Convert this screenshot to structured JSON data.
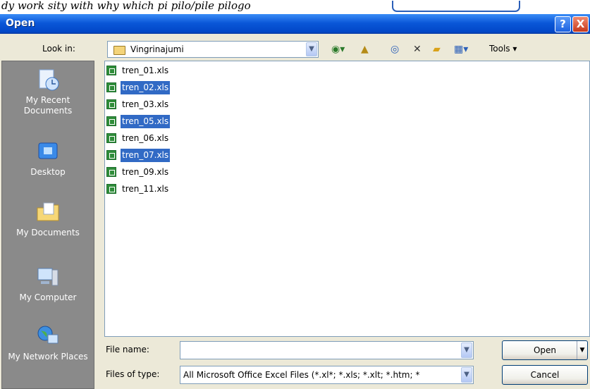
{
  "background": {
    "text": "dy work sity with why which pi pilo/pile pilogo"
  },
  "window": {
    "title": "Open",
    "help_symbol": "?",
    "close_symbol": "X"
  },
  "toolbar": {
    "look_in_label": "Look in:",
    "look_in_value": "Vingrinajumi",
    "tools_label": "Tools",
    "icons": [
      "back-icon",
      "up-folder-icon",
      "search-web-icon",
      "delete-icon",
      "new-folder-icon",
      "views-icon"
    ]
  },
  "places": [
    {
      "label": "My Recent Documents",
      "icon": "recent-documents-icon"
    },
    {
      "label": "Desktop",
      "icon": "desktop-icon"
    },
    {
      "label": "My Documents",
      "icon": "my-documents-icon"
    },
    {
      "label": "My Computer",
      "icon": "my-computer-icon"
    },
    {
      "label": "My Network Places",
      "icon": "network-places-icon"
    }
  ],
  "files": [
    {
      "name": "tren_01.xls",
      "selected": false
    },
    {
      "name": "tren_02.xls",
      "selected": true
    },
    {
      "name": "tren_03.xls",
      "selected": false
    },
    {
      "name": "tren_05.xls",
      "selected": true
    },
    {
      "name": "tren_06.xls",
      "selected": false
    },
    {
      "name": "tren_07.xls",
      "selected": true
    },
    {
      "name": "tren_09.xls",
      "selected": false
    },
    {
      "name": "tren_11.xls",
      "selected": false
    }
  ],
  "file_name": {
    "label": "File name:",
    "value": ""
  },
  "file_type": {
    "label": "Files of type:",
    "value": "All Microsoft Office Excel Files (*.xl*; *.xls; *.xlt; *.htm; *"
  },
  "buttons": {
    "open": "Open",
    "cancel": "Cancel"
  },
  "colors": {
    "selection": "#316ac5",
    "titlebar": "#0a57d8",
    "dialog": "#ece9d8"
  }
}
